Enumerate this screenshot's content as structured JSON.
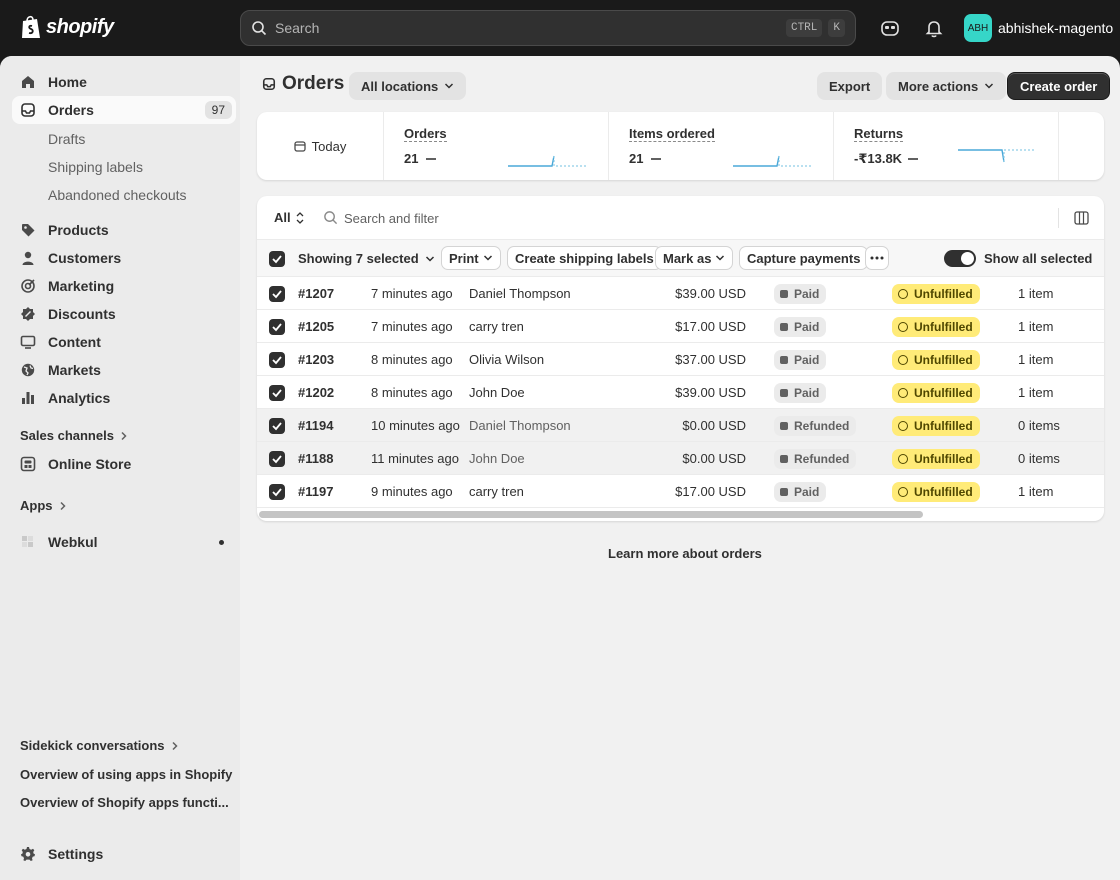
{
  "topbar": {
    "brand": "shopify",
    "search_placeholder": "Search",
    "shortcut_ctrl": "CTRL",
    "shortcut_key": "K",
    "user_initials": "ABH",
    "user_name": "abhishek-magento"
  },
  "sidebar": {
    "home": "Home",
    "orders": "Orders",
    "orders_count": "97",
    "orders_sub": [
      "Drafts",
      "Shipping labels",
      "Abandoned checkouts"
    ],
    "products": "Products",
    "customers": "Customers",
    "marketing": "Marketing",
    "discounts": "Discounts",
    "content": "Content",
    "markets": "Markets",
    "analytics": "Analytics",
    "sales_channels": "Sales channels",
    "online_store": "Online Store",
    "apps": "Apps",
    "webkul": "Webkul",
    "sidekick": "Sidekick conversations",
    "sidekick_items": [
      "Overview of using apps in Shopify",
      "Overview of Shopify apps functi..."
    ],
    "settings": "Settings"
  },
  "header": {
    "title": "Orders",
    "location": "All locations",
    "export": "Export",
    "more_actions": "More actions",
    "create_order": "Create order"
  },
  "metrics": {
    "period": "Today",
    "orders_label": "Orders",
    "orders_value": "21",
    "items_label": "Items ordered",
    "items_value": "21",
    "returns_label": "Returns",
    "returns_value": "-₹13.8K"
  },
  "filters": {
    "view": "All",
    "search_placeholder": "Search and filter"
  },
  "bulk": {
    "selected": "Showing 7 selected",
    "print": "Print",
    "shipping": "Create shipping labels",
    "mark_as": "Mark as",
    "capture": "Capture payments",
    "show_all": "Show all selected"
  },
  "orders": [
    {
      "id": "#1207",
      "date": "7 minutes ago",
      "customer": "Daniel Thompson",
      "total": "$39.00 USD",
      "payment": "Paid",
      "fulfillment": "Unfulfilled",
      "items": "1 item"
    },
    {
      "id": "#1205",
      "date": "7 minutes ago",
      "customer": "carry tren",
      "total": "$17.00 USD",
      "payment": "Paid",
      "fulfillment": "Unfulfilled",
      "items": "1 item"
    },
    {
      "id": "#1203",
      "date": "8 minutes ago",
      "customer": "Olivia Wilson",
      "total": "$37.00 USD",
      "payment": "Paid",
      "fulfillment": "Unfulfilled",
      "items": "1 item"
    },
    {
      "id": "#1202",
      "date": "8 minutes ago",
      "customer": "John Doe",
      "total": "$39.00 USD",
      "payment": "Paid",
      "fulfillment": "Unfulfilled",
      "items": "1 item"
    },
    {
      "id": "#1194",
      "date": "10 minutes ago",
      "customer": "Daniel Thompson",
      "total": "$0.00 USD",
      "payment": "Refunded",
      "fulfillment": "Unfulfilled",
      "items": "0 items"
    },
    {
      "id": "#1188",
      "date": "11 minutes ago",
      "customer": "John Doe",
      "total": "$0.00 USD",
      "payment": "Refunded",
      "fulfillment": "Unfulfilled",
      "items": "0 items"
    },
    {
      "id": "#1197",
      "date": "9 minutes ago",
      "customer": "carry tren",
      "total": "$17.00 USD",
      "payment": "Paid",
      "fulfillment": "Unfulfilled",
      "items": "1 item"
    }
  ],
  "footer": {
    "learn_more": "Learn more about orders"
  },
  "colors": {
    "accent_teal": "#36d6c8",
    "unfulfilled_yellow": "#ffeb78",
    "spark_blue": "#4aa8d8"
  }
}
